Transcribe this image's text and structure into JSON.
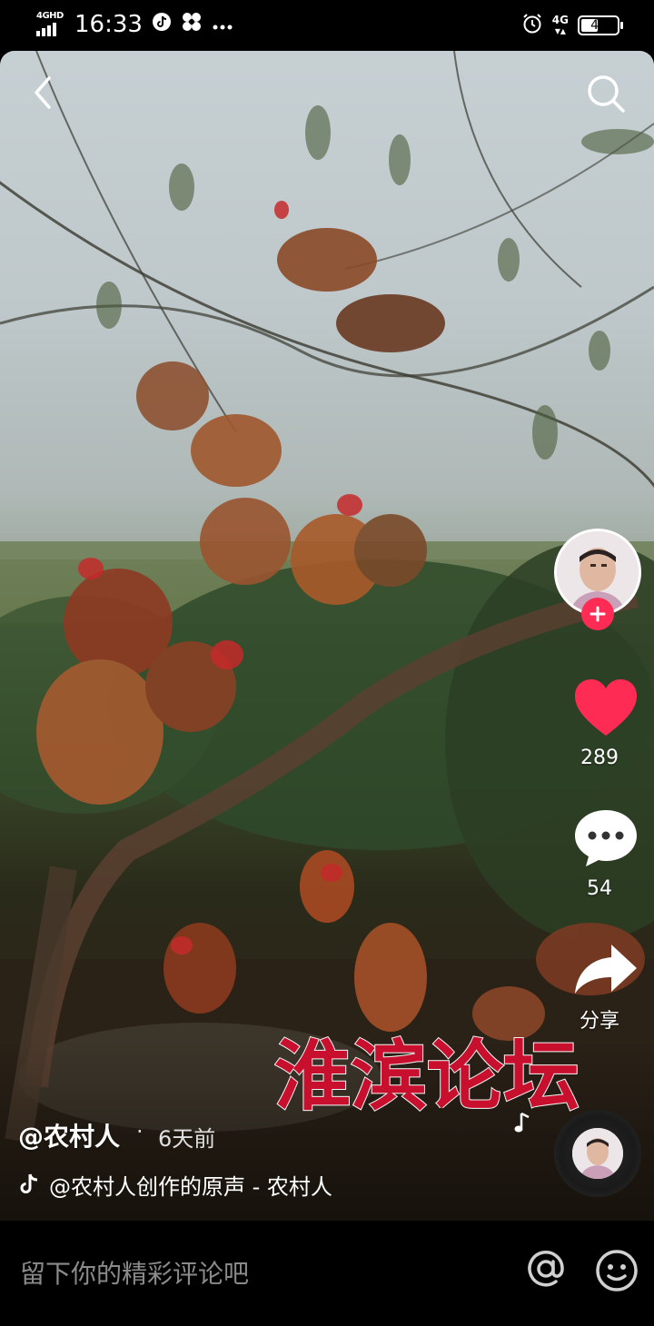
{
  "status_bar": {
    "time": "16:33",
    "network_left": "4GHD",
    "network_right": "4G",
    "battery": "48"
  },
  "video": {
    "author": "@农村人",
    "separator": "·",
    "time_ago": "6天前",
    "music": "@农村人创作的原声 - 农村人",
    "watermark": "淮滨论坛"
  },
  "actions": {
    "likes": "289",
    "comments": "54",
    "share": "分享"
  },
  "comment_bar": {
    "placeholder": "留下你的精彩评论吧"
  },
  "colors": {
    "accent": "#fe2c55",
    "watermark": "#c8102e"
  },
  "icons": [
    "back-icon",
    "search-icon",
    "heart-icon",
    "comment-icon",
    "share-icon",
    "music-note-icon",
    "at-icon",
    "emoji-icon"
  ]
}
